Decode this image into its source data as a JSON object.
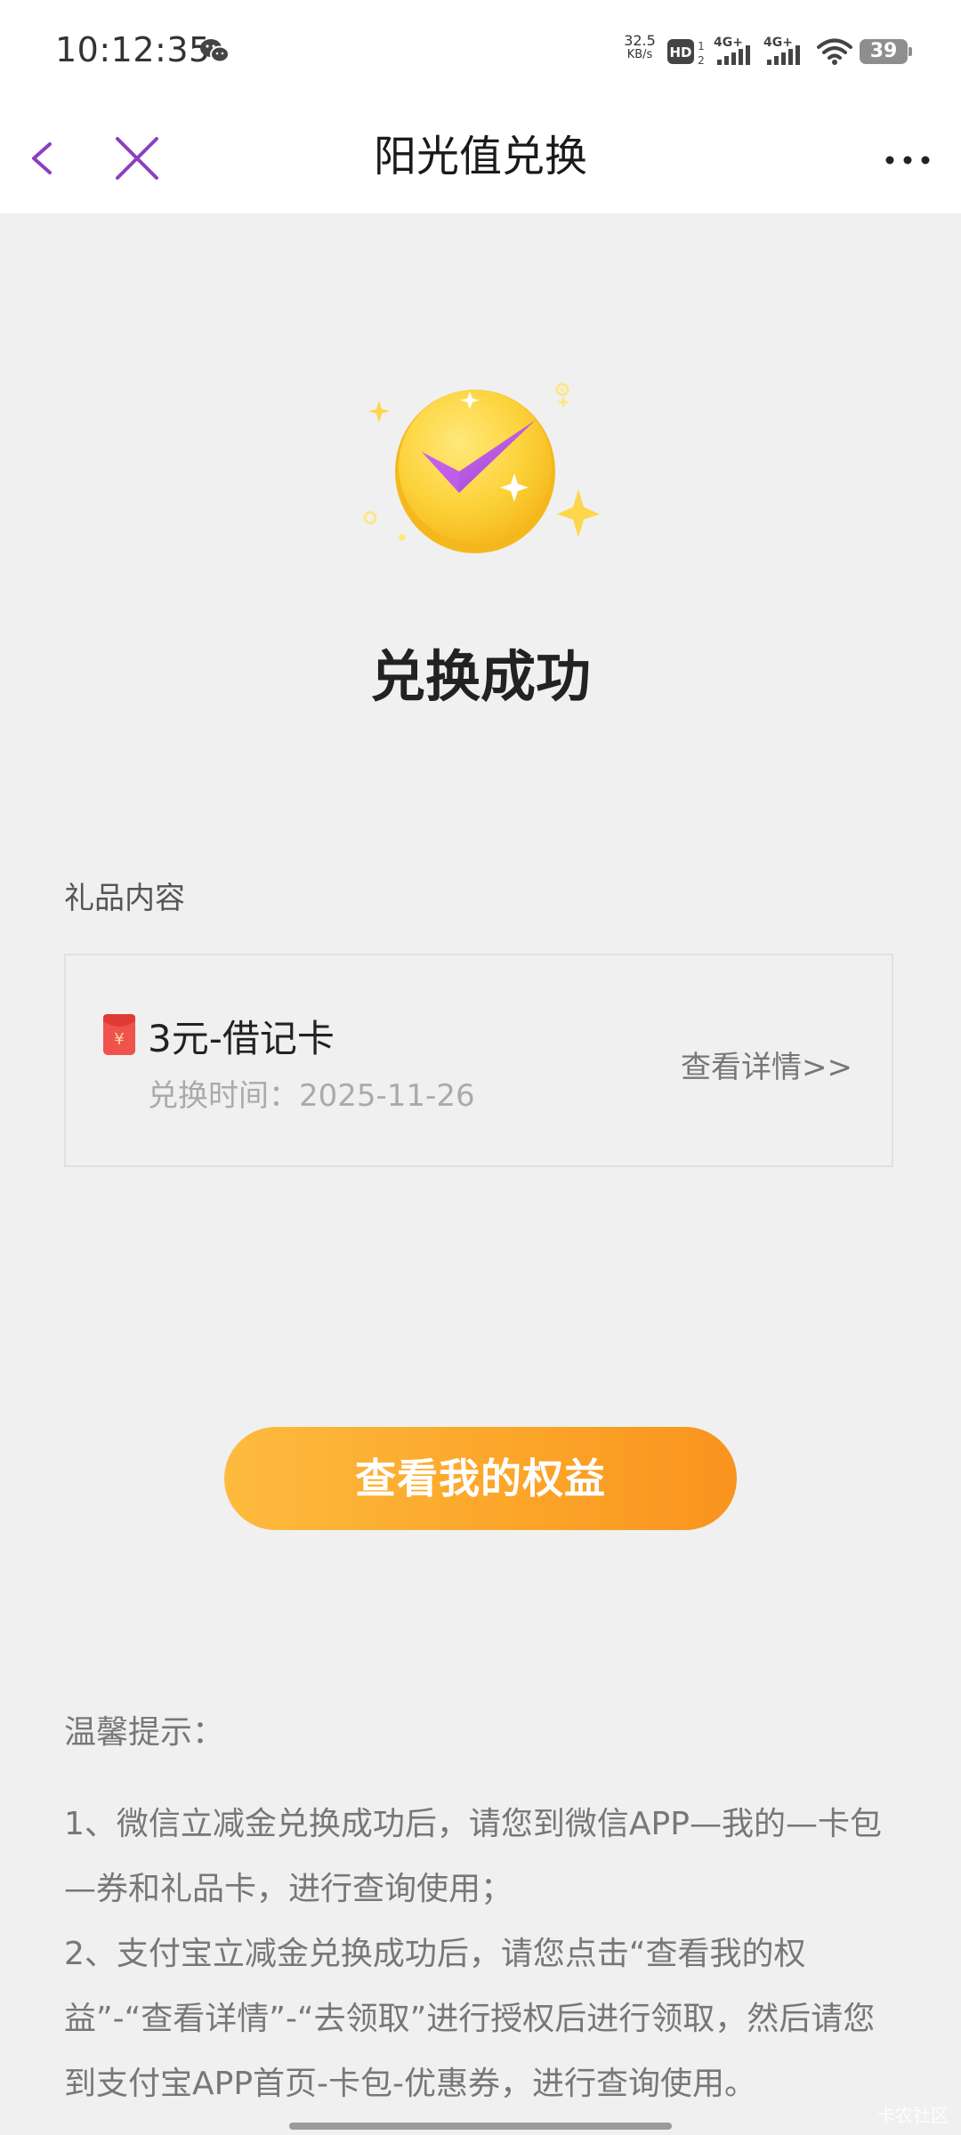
{
  "status_bar": {
    "time": "10:12:35",
    "net_speed_value": "32.5",
    "net_speed_unit": "KB/s",
    "hd_label": "HD",
    "sim1_label": "4G+",
    "sim2_label": "4G+",
    "battery_level": "39",
    "icons": [
      "wechat-icon",
      "hd-icon",
      "signal-icon",
      "wifi-icon",
      "battery-icon"
    ]
  },
  "nav": {
    "title": "阳光值兑换",
    "back_icon": "chevron-left-icon",
    "close_icon": "close-icon",
    "more_icon": "more-icon"
  },
  "result": {
    "title": "兑换成功",
    "icon": "success-check-icon"
  },
  "gift": {
    "section_label": "礼品内容",
    "name": "3元-借记卡",
    "time_label": "兑换时间：",
    "time_value": "2025-11-26",
    "detail_link": "查看详情>>",
    "icon": "red-packet-icon"
  },
  "primary_button": {
    "label": "查看我的权益"
  },
  "tips": {
    "title": "温馨提示：",
    "items": [
      "1、微信立减金兑换成功后，请您到微信APP—我的—卡包—券和礼品卡，进行查询使用；",
      "2、支付宝立减金兑换成功后，请您点击“查看我的权益”-“查看详情”-“去领取”进行授权后进行领取，然后请您到支付宝APP首页-卡包-优惠券，进行查询使用。"
    ]
  },
  "watermark": "卡农社区",
  "colors": {
    "accent_purple": "#8a3fc0",
    "button_orange_start": "#fdbb3e",
    "button_orange_end": "#f9941e",
    "background": "#f0f0f0",
    "coin_yellow": "#fcd23a"
  }
}
